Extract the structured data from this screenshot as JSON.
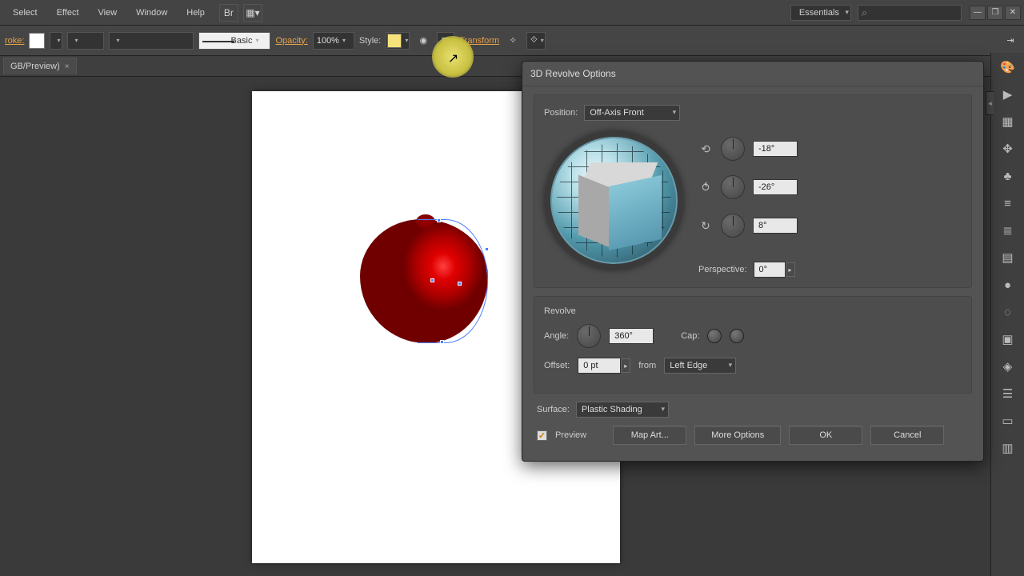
{
  "menubar": {
    "items": [
      "Select",
      "Effect",
      "View",
      "Window",
      "Help"
    ],
    "workspace": "Essentials"
  },
  "window_controls": {
    "min": "—",
    "max": "❐",
    "close": "✕"
  },
  "toolbar": {
    "stroke_label": "roke:",
    "brush": "Basic",
    "opacity_label": "Opacity:",
    "opacity_value": "100%",
    "style_label": "Style:",
    "transform_label": "Transform"
  },
  "tab": {
    "name": "GB/Preview)",
    "close": "×"
  },
  "dialog": {
    "title": "3D Revolve Options",
    "position_label": "Position:",
    "position_value": "Off-Axis Front",
    "rot_x": "-18°",
    "rot_y": "-26°",
    "rot_z": "8°",
    "perspective_label": "Perspective:",
    "perspective_value": "0°",
    "revolve_title": "Revolve",
    "angle_label": "Angle:",
    "angle_value": "360°",
    "cap_label": "Cap:",
    "offset_label": "Offset:",
    "offset_value": "0 pt",
    "from_label": "from",
    "from_value": "Left Edge",
    "surface_label": "Surface:",
    "surface_value": "Plastic Shading",
    "preview_label": "Preview",
    "map_art": "Map Art...",
    "more_options": "More Options",
    "ok": "OK",
    "cancel": "Cancel"
  },
  "dock_icons": [
    "🎨",
    "▶",
    "▦",
    "✥",
    "♣",
    "≡",
    "≣",
    "▤",
    "●",
    "◌",
    "▣",
    "◈",
    "☰",
    "▭",
    "▥"
  ]
}
